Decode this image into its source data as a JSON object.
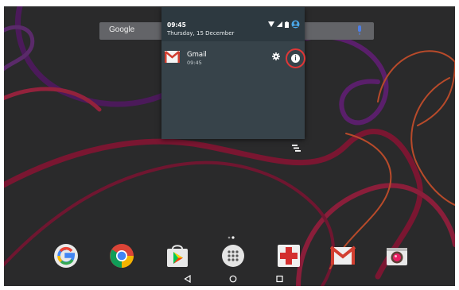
{
  "search": {
    "logo_text": "Google"
  },
  "notification_shade": {
    "time": "09:45",
    "date": "Thursday, 15 December",
    "status_icons": [
      "wifi-icon",
      "signal-icon",
      "battery-icon",
      "account-icon"
    ]
  },
  "notification": {
    "app_name": "Gmail",
    "time": "09:45",
    "actions": [
      "settings-icon",
      "info-icon"
    ]
  },
  "dock": {
    "apps": [
      "google-app-icon",
      "chrome-icon",
      "play-store-icon",
      "app-drawer-icon",
      "first-aid-icon",
      "gmail-icon",
      "camera-icon"
    ]
  },
  "navigation": [
    "back-icon",
    "home-icon",
    "recents-icon"
  ],
  "colors": {
    "shade_bg": "#37434a",
    "shade_header": "#2d3940",
    "highlight_ring": "#e03737",
    "account_blue": "#4aa7e8"
  }
}
